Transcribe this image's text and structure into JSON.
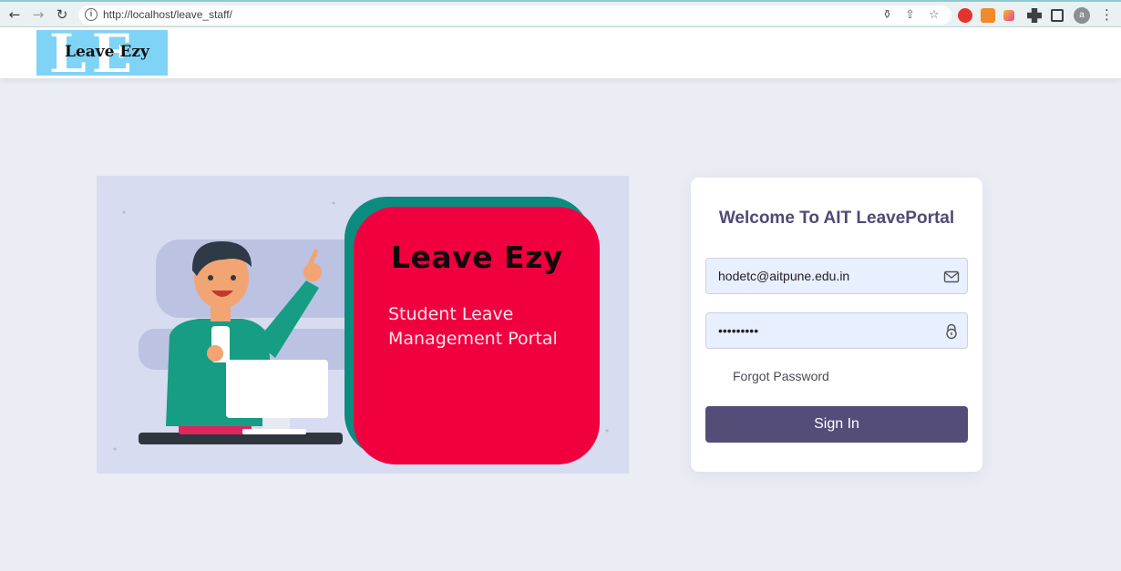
{
  "browser": {
    "url": "http://localhost/leave_staff/",
    "avatar_letter": "a"
  },
  "header": {
    "logo_background_letters": "LE",
    "logo_text": "Leave Ezy"
  },
  "hero": {
    "title": "Leave Ezy",
    "subtitle_line1": "Student Leave",
    "subtitle_line2": "Management Portal"
  },
  "login": {
    "title": "Welcome To AIT LeavePortal",
    "email_value": "hodetc@aitpune.edu.in",
    "password_value": "hunter2pw",
    "forgot_label": "Forgot Password",
    "signin_label": "Sign In"
  },
  "icons": {
    "back": "arrow-left-icon",
    "forward": "arrow-right-icon",
    "reload": "reload-icon",
    "site_info": "info-icon",
    "key": "key-icon",
    "share": "share-icon",
    "star": "star-icon",
    "email": "envelope-icon",
    "password": "lock-icon"
  },
  "colors": {
    "page_bg": "#eaedf4",
    "primary_button": "#534d78",
    "title": "#4f4a75",
    "hero_card": "#f1003f",
    "hero_card_shadow": "#0c8c7f",
    "logo_bg": "#7fd3f6",
    "input_bg": "#e8effe"
  }
}
